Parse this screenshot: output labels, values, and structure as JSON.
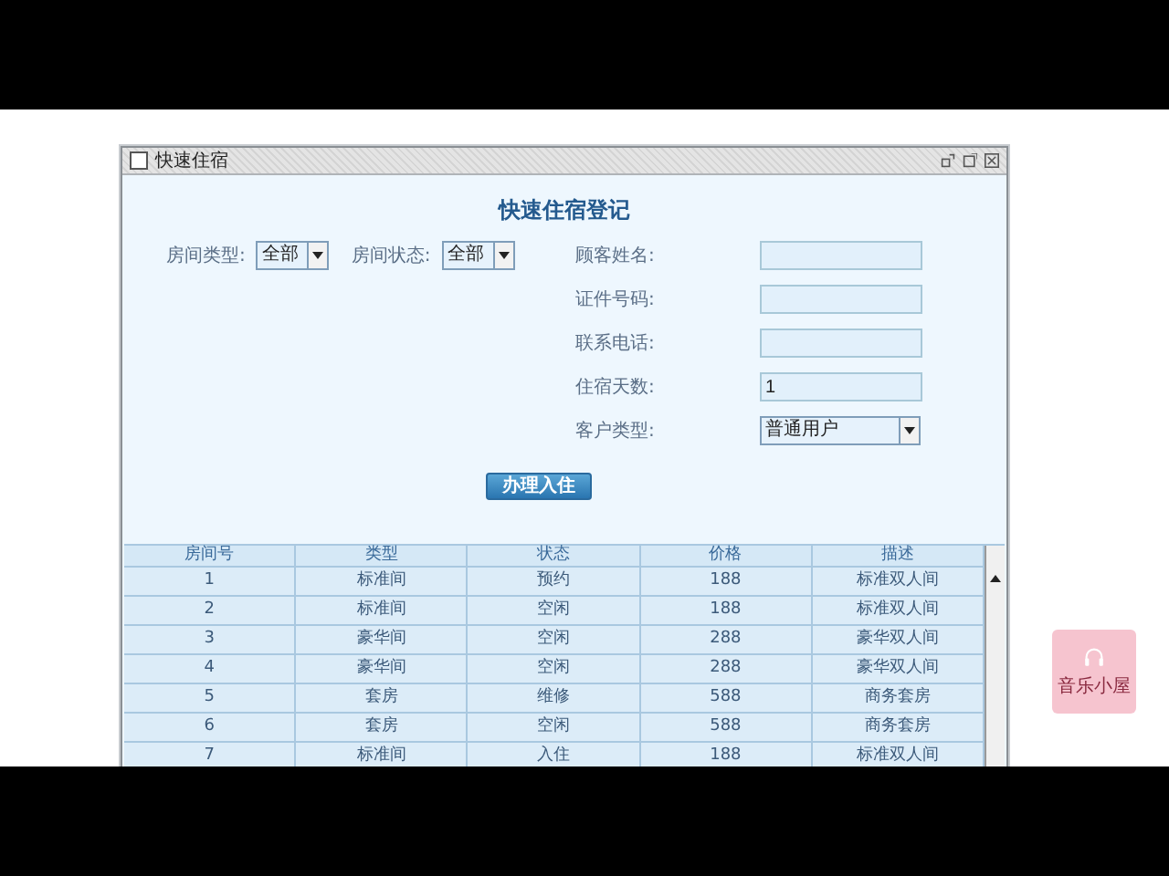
{
  "window": {
    "title": "快速住宿"
  },
  "heading": "快速住宿登记",
  "filters": [
    {
      "label": "房间类型:",
      "value": "全部"
    },
    {
      "label": "房间状态:",
      "value": "全部"
    }
  ],
  "fields": [
    {
      "kind": "text",
      "label": "顾客姓名:"
    },
    {
      "kind": "text",
      "label": "证件号码:"
    },
    {
      "kind": "text",
      "label": "联系电话:"
    },
    {
      "kind": "text",
      "label": "住宿天数:",
      "value": "1"
    },
    {
      "kind": "select",
      "label": "客户类型:",
      "value": "普通用户"
    }
  ],
  "submit_button": "办理入住",
  "table": {
    "columns": [
      "房间号",
      "类型",
      "状态",
      "价格",
      "描述"
    ],
    "rows": [
      [
        "1",
        "标准间",
        "预约",
        "188",
        "标准双人间"
      ],
      [
        "2",
        "标准间",
        "空闲",
        "188",
        "标准双人间"
      ],
      [
        "3",
        "豪华间",
        "空闲",
        "288",
        "豪华双人间"
      ],
      [
        "4",
        "豪华间",
        "空闲",
        "288",
        "豪华双人间"
      ],
      [
        "5",
        "套房",
        "维修",
        "588",
        "商务套房"
      ],
      [
        "6",
        "套房",
        "空闲",
        "588",
        "商务套房"
      ],
      [
        "7",
        "标准间",
        "入住",
        "188",
        "标准双人间"
      ]
    ]
  },
  "widget": {
    "label": "音乐小屋"
  }
}
